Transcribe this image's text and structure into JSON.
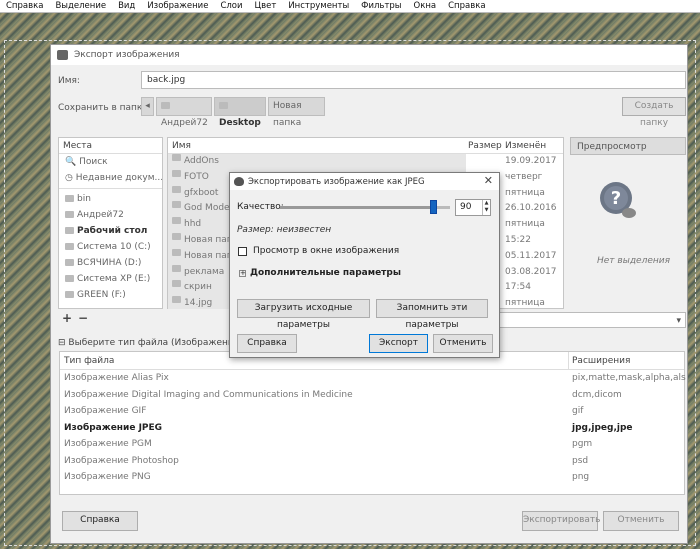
{
  "menubar": [
    "Справка",
    "Выделение",
    "Вид",
    "Изображение",
    "Слои",
    "Цвет",
    "Инструменты",
    "Фильтры",
    "Окна",
    "Справка"
  ],
  "main": {
    "title": "Экспорт изображения",
    "name_label": "Имя:",
    "name_value": "back.jpg",
    "save_in_label": "Сохранить в папке",
    "crumbs": [
      "Андрей72",
      "Desktop",
      "Новая папка"
    ],
    "create_folder": "Создать папку",
    "places_header": "Места",
    "places": [
      "Поиск",
      "Недавние докум...",
      "bin",
      "Андрей72",
      "Рабочий стол",
      "Система 10 (C:)",
      "ВСЯЧИНА (D:)",
      "Система XP (E:)",
      "GREEN (F:)"
    ],
    "files_columns": [
      "Имя",
      "Размер",
      "Изменён"
    ],
    "files": [
      {
        "name": "AddOns",
        "date": "19.09.2017"
      },
      {
        "name": "FOTO",
        "date": "четверг"
      },
      {
        "name": "gfxboot",
        "date": "пятница"
      },
      {
        "name": "God Mode.{",
        "date": "26.10.2016"
      },
      {
        "name": "hhd",
        "date": "пятница"
      },
      {
        "name": "Новая папк",
        "date": "15:22"
      },
      {
        "name": "Новая папк",
        "date": "05.11.2017"
      },
      {
        "name": "реклама",
        "date": "03.08.2017"
      },
      {
        "name": "скрин",
        "date": "17:54"
      },
      {
        "name": "14.jpg",
        "date": "пятница"
      }
    ],
    "preview_header": "Предпросмотр",
    "no_selection": "Нет выделения",
    "filetype_expander": "Выберите тип файла (Изображение JPE",
    "types_columns": [
      "Тип файла",
      "Расширения"
    ],
    "types": [
      {
        "name": "Изображение Alias Pix",
        "ext": "pix,matte,mask,alpha,als"
      },
      {
        "name": "Изображение Digital Imaging and Communications in Medicine",
        "ext": "dcm,dicom"
      },
      {
        "name": "Изображение GIF",
        "ext": "gif"
      },
      {
        "name": "Изображение JPEG",
        "ext": "jpg,jpeg,jpe"
      },
      {
        "name": "Изображение PGM",
        "ext": "pgm"
      },
      {
        "name": "Изображение Photoshop",
        "ext": "psd"
      },
      {
        "name": "Изображение PNG",
        "ext": "png"
      }
    ],
    "help_btn": "Справка",
    "export_btn": "Экспортировать",
    "cancel_btn": "Отменить",
    "add_icon": "+",
    "remove_icon": "−"
  },
  "jpeg": {
    "title": "Экспортировать изображение как JPEG",
    "quality_label": "Качество:",
    "quality_value": "90",
    "quality_fraction": 0.9,
    "size_label": "Размер: неизвестен",
    "preview_check": "Просмотр в окне изображения",
    "advanced": "Дополнительные параметры",
    "load_defaults": "Загрузить исходные параметры",
    "save_defaults": "Запомнить эти параметры",
    "help": "Справка",
    "export": "Экспорт",
    "cancel": "Отменить"
  }
}
